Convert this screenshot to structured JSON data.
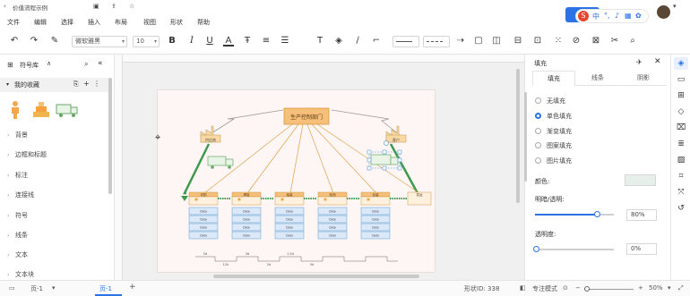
{
  "window": {
    "title": "价值流程示例"
  },
  "menu": [
    "文件",
    "编辑",
    "选择",
    "插入",
    "布局",
    "视图",
    "形状",
    "帮助"
  ],
  "toolbar": {
    "font_family": "微软雅黑",
    "font_size": "10"
  },
  "ime": {
    "lang": "中"
  },
  "library": {
    "title": "符号库",
    "favorites": "我的收藏",
    "categories": [
      "背景",
      "边框和标题",
      "标注",
      "连接线",
      "符号",
      "线条",
      "文本",
      "文本块"
    ]
  },
  "format_panel": {
    "title": "填充",
    "tabs": [
      "填充",
      "线条",
      "阴影"
    ],
    "fill_options": [
      "无填充",
      "单色填充",
      "渐变填充",
      "图案填充",
      "图片填充"
    ],
    "selected_fill": "单色填充",
    "color_label": "颜色:",
    "shade_label": "明暗/透明:",
    "shade_value": "80%",
    "transparency_label": "透明度:",
    "transparency_value": "0%",
    "shade_level": 0.8,
    "transparency_level": 0.0
  },
  "diagram": {
    "control_center": "生产控制部门",
    "supplier": "供应商",
    "customer": "客户",
    "processes": [
      "切割",
      "焊接",
      "组装",
      "检测",
      "包装",
      "发运"
    ],
    "data_cells": [
      "Data",
      "Data",
      "Data",
      "Data"
    ],
    "timeline": [
      "5d",
      "12h",
      "3d",
      "2d",
      "1.5d",
      "3d"
    ]
  },
  "status": {
    "page_tab_left": "页-1",
    "page_tab_active": "页-1",
    "shape_id_label": "形状ID: 338",
    "focus_mode": "专注模式",
    "zoom": "50%"
  },
  "colors": {
    "accent": "#2a72e5",
    "orange_fill": "#f6c07a",
    "diagram_line": "#e0a24a",
    "diagram_green": "#3e9b4e",
    "diagram_blue": "#5b9bd5"
  }
}
